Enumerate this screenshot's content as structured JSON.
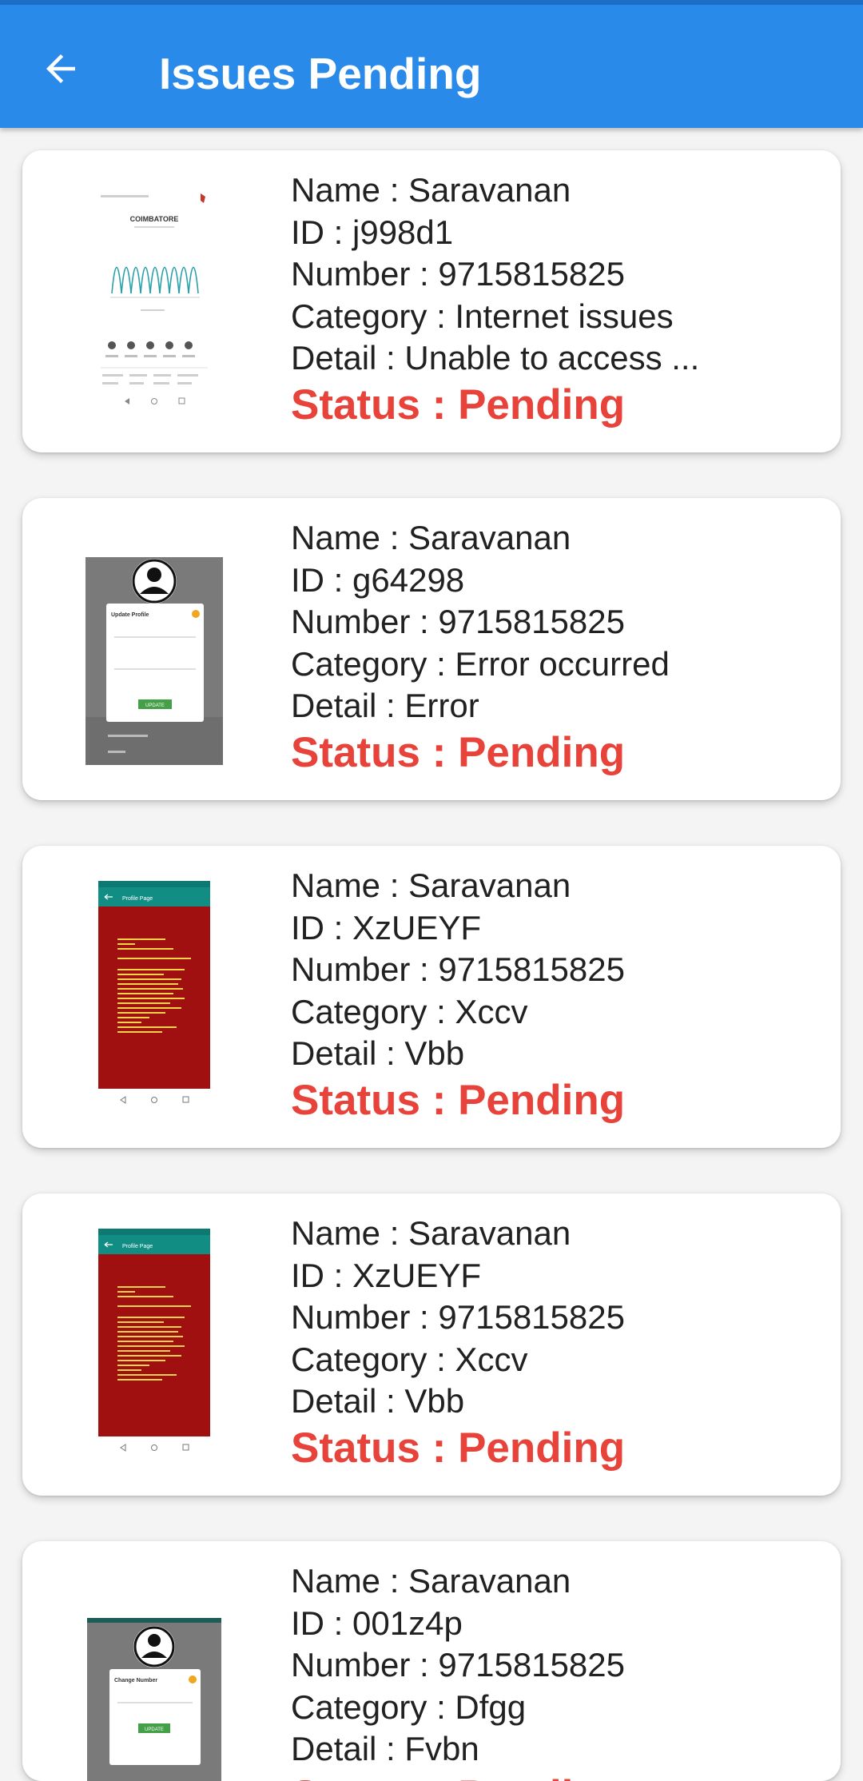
{
  "appbar": {
    "title": "Issues Pending",
    "back_icon": "arrow-left-icon",
    "color": "#2a8aea"
  },
  "colors": {
    "status": "#e8433a",
    "text": "#212121",
    "card": "#ffffff",
    "background": "#f4f4f4"
  },
  "labels": {
    "name": "Name : ",
    "id": "ID : ",
    "number": "Number : ",
    "category": "Category : ",
    "detail": "Detail : ",
    "status": "Status : "
  },
  "issues": [
    {
      "name": "Name : Saravanan",
      "id": "ID : j998d1",
      "number": "Number : 9715815825",
      "category": "Category : Internet issues",
      "detail": "Detail : Unable to access ...",
      "status": "Status : Pending",
      "thumbnail": "weather-app-screenshot",
      "thumb_text": {
        "city": "COIMBATORE"
      }
    },
    {
      "name": "Name : Saravanan",
      "id": "ID : g64298",
      "number": "Number : 9715815825",
      "category": "Category : Error occurred",
      "detail": "Detail : Error",
      "status": "Status : Pending",
      "thumbnail": "update-profile-dialog-screenshot",
      "thumb_text": {
        "dialog": "Update Profile",
        "button": "UPDATE"
      }
    },
    {
      "name": "Name : Saravanan",
      "id": "ID : XzUEYF",
      "number": "Number : 9715815825",
      "category": "Category : Xccv",
      "detail": "Detail : Vbb",
      "status": "Status : Pending",
      "thumbnail": "error-screen-screenshot",
      "thumb_text": {
        "page": "Profile Page"
      }
    },
    {
      "name": "Name : Saravanan",
      "id": "ID : XzUEYF",
      "number": "Number : 9715815825",
      "category": "Category : Xccv",
      "detail": "Detail : Vbb",
      "status": "Status : Pending",
      "thumbnail": "error-screen-screenshot",
      "thumb_text": {
        "page": "Profile Page"
      }
    },
    {
      "name": "Name : Saravanan",
      "id": "ID : 001z4p",
      "number": "Number : 9715815825",
      "category": "Category : Dfgg",
      "detail": "Detail : Fvbn",
      "status": "Status : Pending",
      "thumbnail": "change-number-dialog-screenshot",
      "thumb_text": {
        "dialog": "Change Number",
        "button": "UPDATE"
      }
    }
  ]
}
